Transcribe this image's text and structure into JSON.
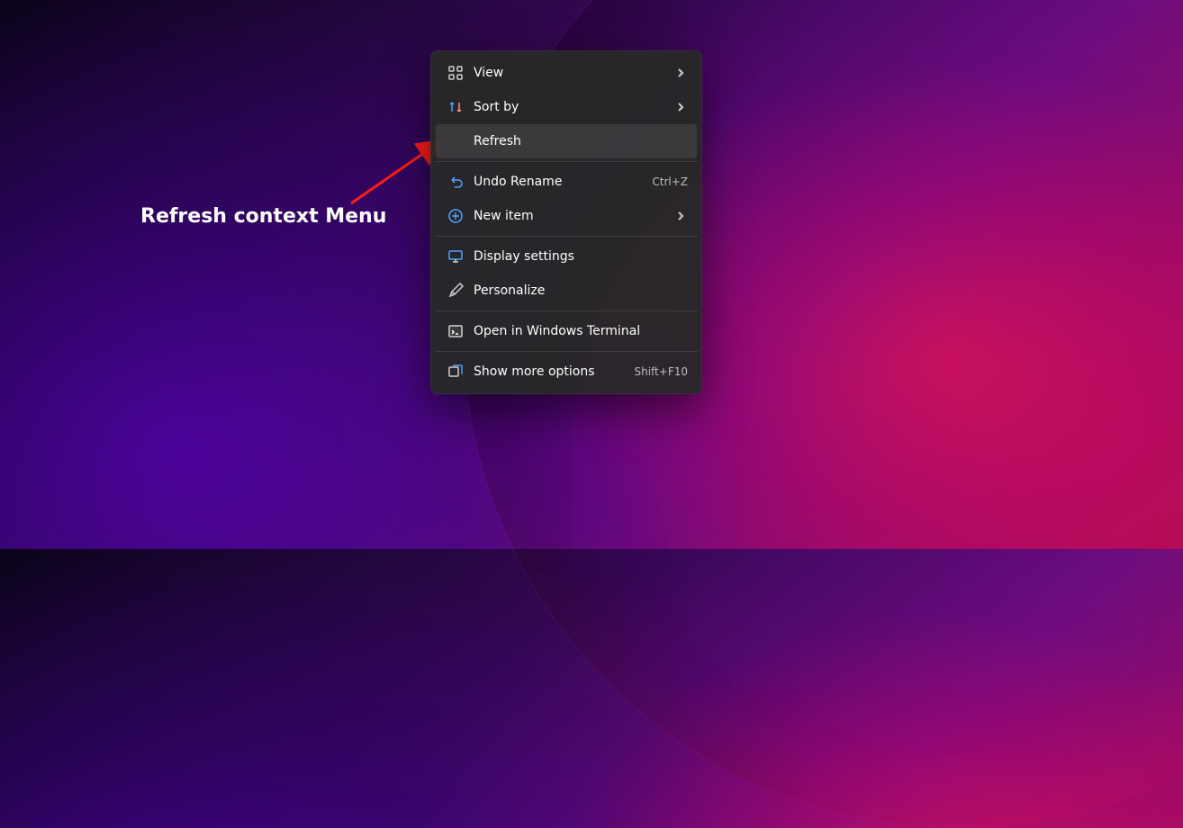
{
  "annotation": {
    "text": "Refresh context Menu"
  },
  "context_menu": {
    "groups": [
      {
        "items": [
          {
            "id": "view",
            "label": "View",
            "icon": "grid",
            "submenu": true
          },
          {
            "id": "sort_by",
            "label": "Sort by",
            "icon": "sort",
            "submenu": true
          },
          {
            "id": "refresh",
            "label": "Refresh",
            "icon": "none",
            "highlight": true
          }
        ]
      },
      {
        "items": [
          {
            "id": "undo_rename",
            "label": "Undo Rename",
            "icon": "undo",
            "shortcut": "Ctrl+Z"
          },
          {
            "id": "new_item",
            "label": "New item",
            "icon": "new",
            "submenu": true
          }
        ]
      },
      {
        "items": [
          {
            "id": "display_settings",
            "label": "Display settings",
            "icon": "display"
          },
          {
            "id": "personalize",
            "label": "Personalize",
            "icon": "brush"
          }
        ]
      },
      {
        "items": [
          {
            "id": "open_terminal",
            "label": "Open in Windows Terminal",
            "icon": "terminal"
          }
        ]
      },
      {
        "items": [
          {
            "id": "show_more",
            "label": "Show more options",
            "icon": "more",
            "shortcut": "Shift+F10"
          }
        ]
      }
    ]
  }
}
